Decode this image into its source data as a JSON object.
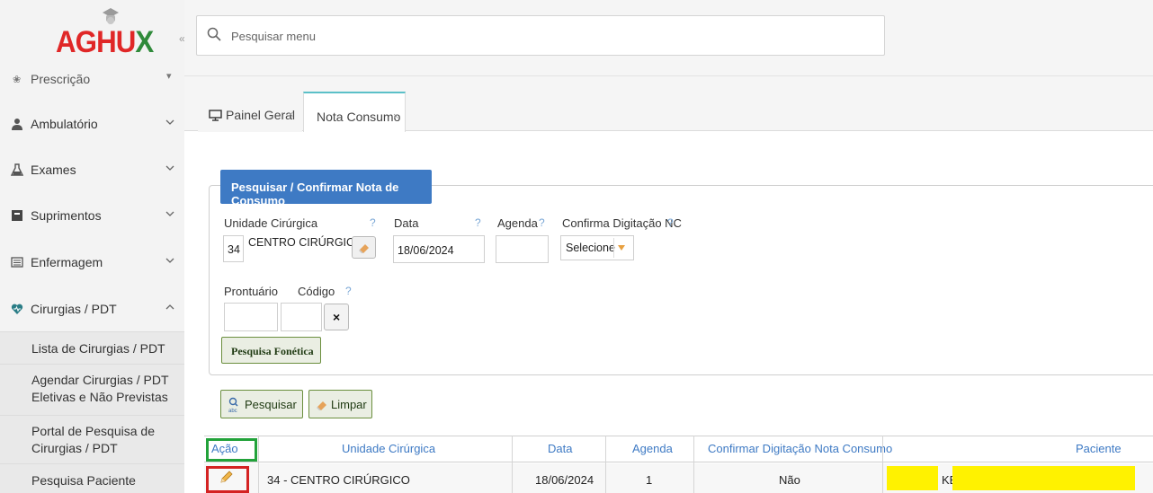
{
  "brand": {
    "logo_text_main": "AGHU",
    "logo_text_x": "X"
  },
  "sidebar": {
    "collapse_icon": "«",
    "items": [
      {
        "label": "Prescrição",
        "icon": "pill-icon"
      },
      {
        "label": "Ambulatório",
        "icon": "doctor-icon"
      },
      {
        "label": "Exames",
        "icon": "flask-icon"
      },
      {
        "label": "Suprimentos",
        "icon": "box-icon"
      },
      {
        "label": "Enfermagem",
        "icon": "list-icon"
      },
      {
        "label": "Cirurgias / PDT",
        "icon": "heart-icon"
      }
    ],
    "subitems": [
      {
        "label": "Lista de Cirurgias / PDT"
      },
      {
        "label_line1": "Agendar Cirurgias / PDT",
        "label_line2": "Eletivas e Não Previstas"
      },
      {
        "label_line1": "Portal de Pesquisa de",
        "label_line2": "Cirurgias / PDT"
      },
      {
        "label": "Pesquisa Paciente Cirúrgico"
      }
    ]
  },
  "search": {
    "placeholder": "Pesquisar menu"
  },
  "tabs": [
    {
      "label": "Painel Geral",
      "close": "×"
    },
    {
      "label": "Nota Consumo",
      "close": "×"
    }
  ],
  "form": {
    "legend": "Pesquisar / Confirmar Nota de Consumo",
    "unidade_label": "Unidade Cirúrgica",
    "unidade_code": "34",
    "unidade_name": "CENTRO CIRÚRGICO",
    "data_label": "Data",
    "data_value": "18/06/2024",
    "agenda_label": "Agenda",
    "confirma_label": "Confirma Digitação NC",
    "confirma_value": "Selecione",
    "prontuario_label": "Prontuário",
    "codigo_label": "Código",
    "help": "?",
    "clear_x": "×",
    "fonetica_button": "Pesquisa Fonética",
    "pesquisar_button": "Pesquisar",
    "limpar_button": "Limpar"
  },
  "table": {
    "headers": [
      "Ação",
      "Unidade Cirúrgica",
      "Data",
      "Agenda",
      "Confirmar Digitação Nota Consumo",
      "Paciente"
    ],
    "rows": [
      {
        "unidade": "34 - CENTRO CIRÚRGICO",
        "data": "18/06/2024",
        "agenda": "1",
        "confirmar": "Não",
        "paciente": "KE"
      }
    ]
  },
  "colors": {
    "accent": "#3e7ac4",
    "highlight_green": "#22a23a",
    "highlight_red": "#d42222",
    "redaction": "#fff200"
  }
}
